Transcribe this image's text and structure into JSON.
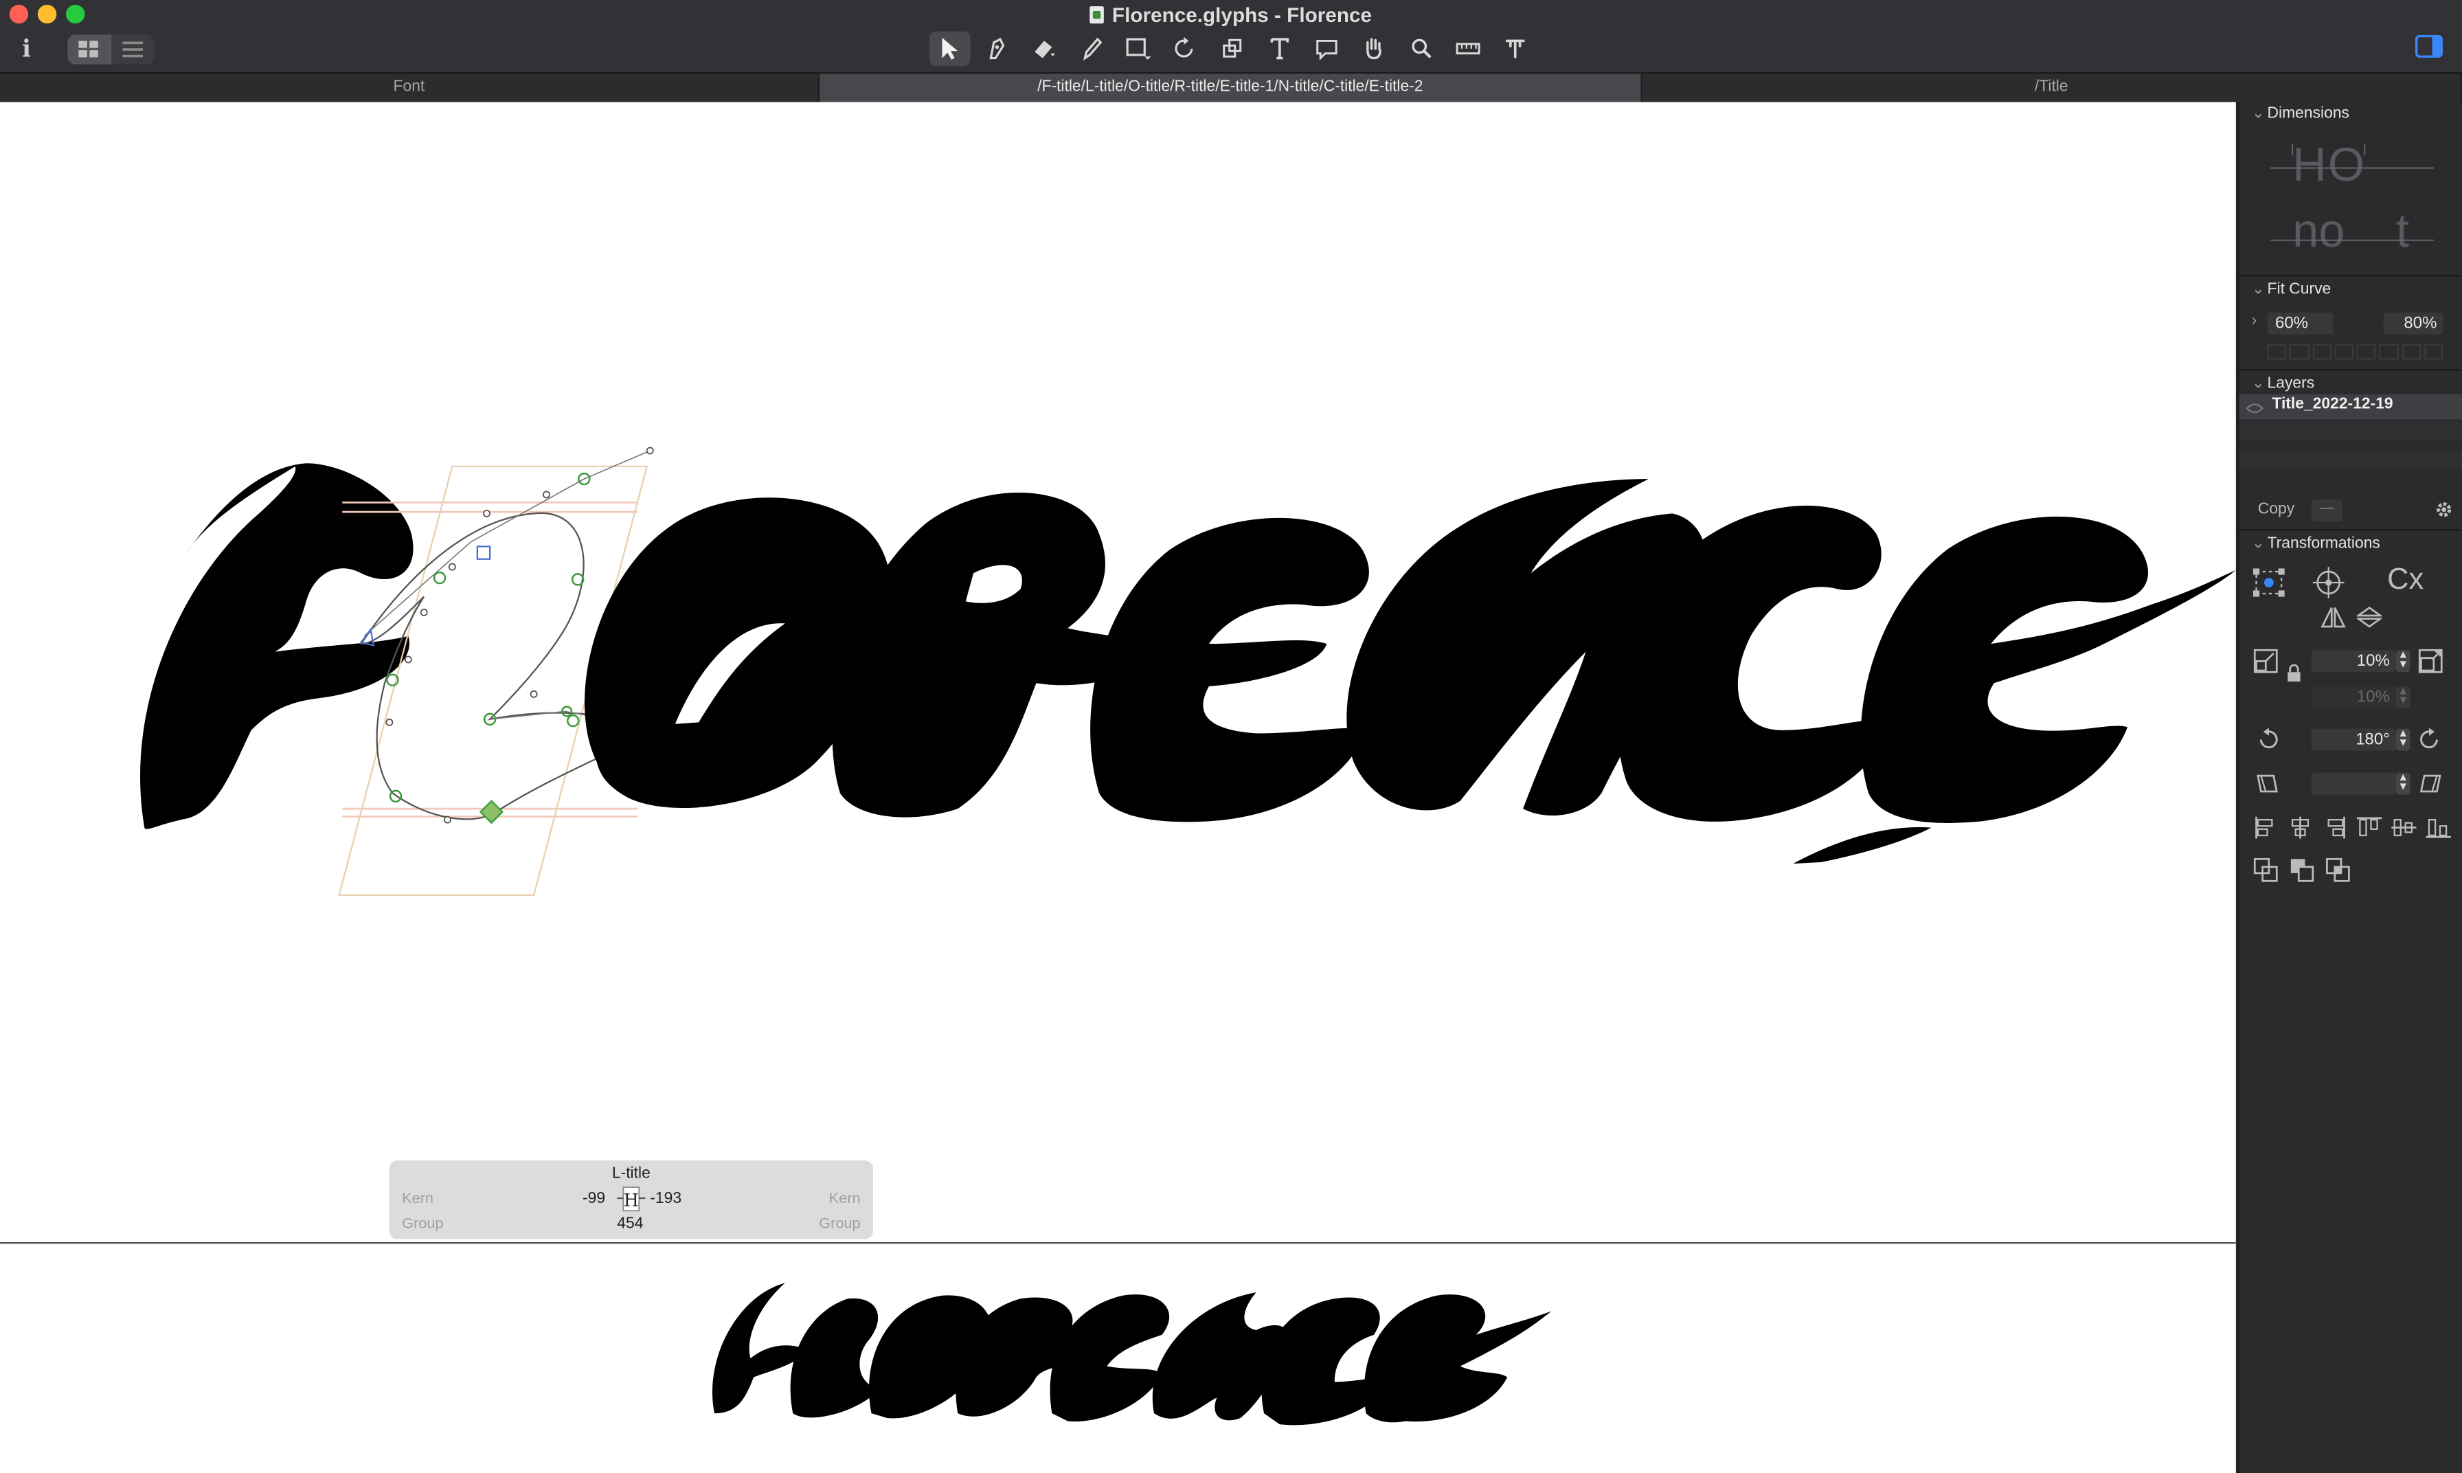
{
  "window": {
    "title": "Florence.glyphs - Florence"
  },
  "tabs": [
    {
      "label": "Font"
    },
    {
      "label": "/F-title/L-title/O-title/R-title/E-title-1/N-title/C-title/E-title-2"
    },
    {
      "label": "/Title"
    }
  ],
  "toolbar": {
    "tools": [
      "select-tool-icon",
      "draw-tool-icon",
      "eraser-tool-icon",
      "pencil-tool-icon",
      "rectangle-tool-icon",
      "rotate-tool-icon",
      "scale-tool-icon",
      "text-tool-icon",
      "annotation-tool-icon",
      "hand-tool-icon",
      "zoom-tool-icon",
      "measure-tool-icon",
      "metrics-tool-icon"
    ]
  },
  "tooltip": {
    "glyph_name": "L-title",
    "kern_left_label": "Kern",
    "kern_right_label": "Kern",
    "group_left_label": "Group",
    "group_right_label": "Group",
    "lsb": "-99",
    "rsb": "-193",
    "width": "454"
  },
  "panel": {
    "dimensions": {
      "title": "Dimensions",
      "preview_top": "HO",
      "preview_bottom_1": "no",
      "preview_bottom_2": "t"
    },
    "fit_curve": {
      "title": "Fit Curve",
      "min": "60%",
      "max": "80%"
    },
    "layers": {
      "title": "Layers",
      "items": [
        {
          "name": "Title_2022-12-19"
        }
      ]
    },
    "copy_label": "Copy",
    "copy_value": "—",
    "transformations": {
      "title": "Transformations",
      "origin_label": "Cx",
      "scale_x": "10%",
      "scale_y": "10%",
      "rotate": "180°",
      "skew": ""
    }
  },
  "canvas": {
    "preview_word": "FLORENCE"
  },
  "colors": {
    "accent": "#2e7cf6",
    "node_green": "#3a9b3a",
    "handle_blue": "#4a6fd0",
    "glyph_ink": "#000000"
  }
}
